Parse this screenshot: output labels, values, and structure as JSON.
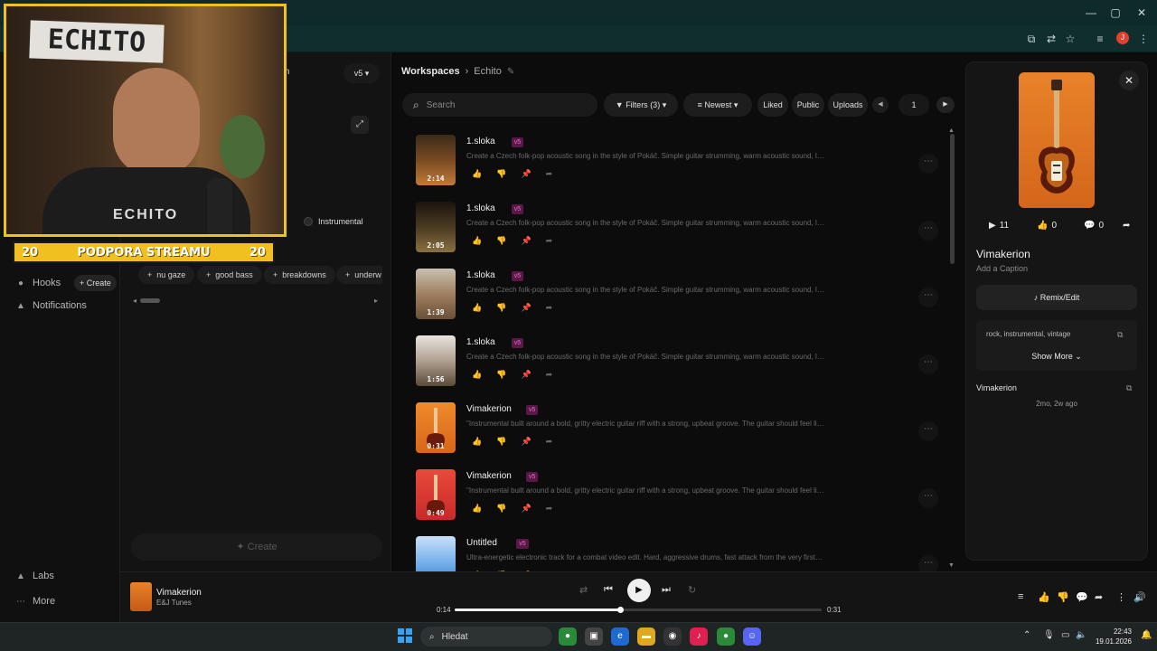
{
  "browser": {
    "window_controls": [
      "—",
      "▢",
      "✕"
    ],
    "profile_initial": "J"
  },
  "sidebar": {
    "items": [
      {
        "label": "Hooks",
        "icon": "hooks-icon"
      },
      {
        "label": "Notifications",
        "icon": "bell-icon"
      },
      {
        "label": "Labs",
        "icon": "flask-icon"
      },
      {
        "label": "More",
        "icon": "more-icon"
      }
    ],
    "create_chip": "+ Create"
  },
  "create_panel": {
    "model_tab_partial": "m",
    "version": "v5",
    "instrumental_label": "Instrumental",
    "style_tags": [
      "nu gaze",
      "good bass",
      "breakdowns",
      "underw"
    ],
    "create_button": "Create"
  },
  "stream_overlay": {
    "sign_text": "ECHITO",
    "shirt_text": "ECHITO",
    "banner_text": "PODPORA STREAMU",
    "banner_left": "20",
    "banner_right": "20"
  },
  "main": {
    "breadcrumb_root": "Workspaces",
    "breadcrumb_current": "Echito",
    "search_placeholder": "Search",
    "filters_label": "Filters (3)",
    "sort_label": "Newest",
    "filter_liked": "Liked",
    "filter_public": "Public",
    "filter_uploads": "Uploads",
    "page_number": "1",
    "songs": [
      {
        "title": "1.sloka",
        "version": "v5",
        "duration": "2:14",
        "description": "Create a Czech folk-pop acoustic song in the style of Pokáč. Simple guitar strumming, warm acoustic sound, light pe...",
        "thumb": "tavern"
      },
      {
        "title": "1.sloka",
        "version": "v5",
        "duration": "2:05",
        "description": "Create a Czech folk-pop acoustic song in the style of Pokáč. Simple guitar strumming, warm acoustic sound, light pe...",
        "thumb": "lights"
      },
      {
        "title": "1.sloka",
        "version": "v5",
        "duration": "1:39",
        "description": "Create a Czech folk-pop acoustic song in the style of Pokáč. Simple guitar strumming, warm acoustic sound, light pe...",
        "thumb": "cabin"
      },
      {
        "title": "1.sloka",
        "version": "v5",
        "duration": "1:56",
        "description": "Create a Czech folk-pop acoustic song in the style of Pokáč. Simple guitar strumming, warm acoustic sound, light pe...",
        "thumb": "tent"
      },
      {
        "title": "Vimakerion",
        "version": "v5",
        "duration": "0:31",
        "description": "\"Instrumental built around a bold, gritty electric guitar riff with a strong, upbeat groove. The guitar should feel lively an...",
        "thumb": "guitar-orange"
      },
      {
        "title": "Vimakerion",
        "version": "v5",
        "duration": "0:49",
        "description": "\"Instrumental built around a bold, gritty electric guitar riff with a strong, upbeat groove. The guitar should feel lively an...",
        "thumb": "guitar-red"
      },
      {
        "title": "Untitled",
        "version": "v5",
        "duration": "",
        "description": "Ultra-energetic electronic track for a combat video edit. Hard, aggressive drums, fast attack from the very first secon...",
        "thumb": "city"
      }
    ]
  },
  "detail": {
    "plays": "11",
    "likes": "0",
    "comments": "0",
    "title": "Vimakerion",
    "caption_placeholder": "Add a Caption",
    "remix_label": "Remix/Edit",
    "tags": "rock, instrumental, vintage",
    "show_more": "Show More",
    "artist": "Vimakerion",
    "time_ago": "2mo, 2w ago"
  },
  "player": {
    "title": "Vimakerion",
    "artist": "E&J Tunes",
    "current_time": "0:14",
    "total_time": "0:31",
    "progress": 0.45
  },
  "taskbar": {
    "search_label": "Hledat",
    "time": "22:43",
    "date": "19.01.2026"
  },
  "colors": {
    "accent_badge": "#e070c8",
    "webcam_frame": "#f0c020",
    "cover_orange": "#e8822a"
  }
}
